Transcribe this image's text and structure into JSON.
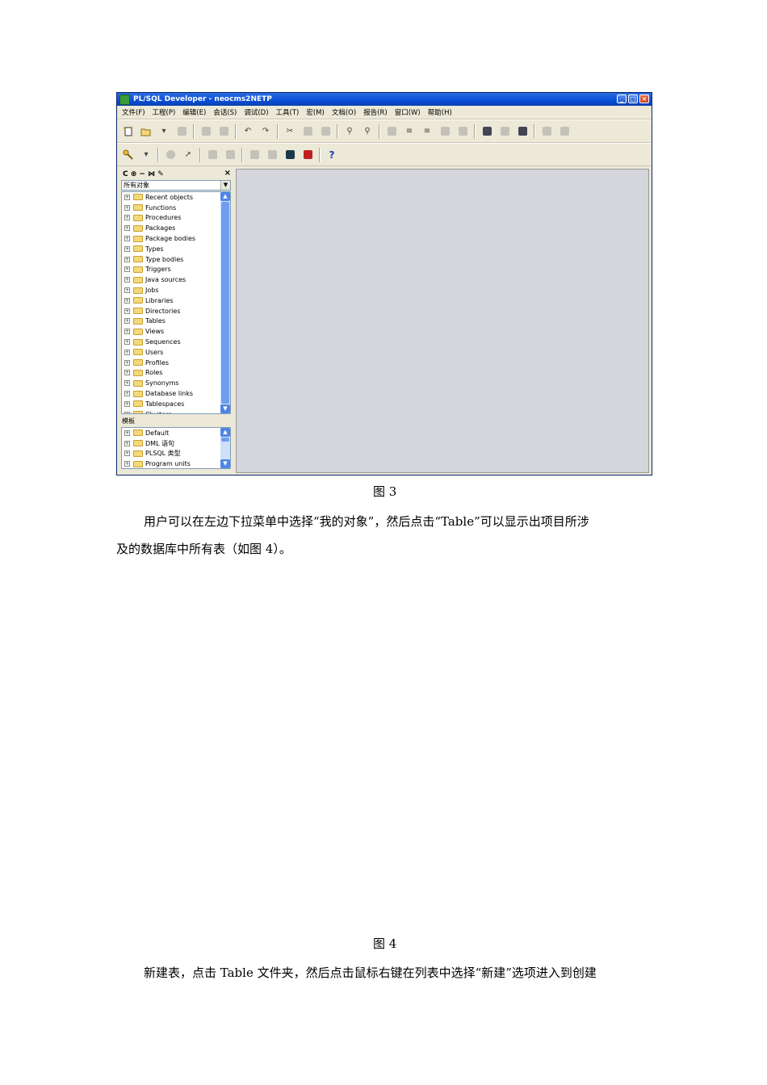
{
  "window": {
    "title": "PL/SQL Developer - neocms2NETP",
    "controls": [
      "_",
      "□",
      "×"
    ],
    "menu": [
      "文件(F)",
      "工程(P)",
      "编辑(E)",
      "会话(S)",
      "调试(D)",
      "工具(T)",
      "宏(M)",
      "文档(O)",
      "报告(R)",
      "窗口(W)",
      "帮助(H)"
    ],
    "toolbar2_help": "?",
    "left_panel": {
      "filter_select": "所有对象",
      "close": "×",
      "tool_glyphs": "C ⊕ − ⋈ ✎",
      "object_tree": [
        "Recent objects",
        "Functions",
        "Procedures",
        "Packages",
        "Package bodies",
        "Types",
        "Type bodies",
        "Triggers",
        "Java sources",
        "Jobs",
        "Libraries",
        "Directories",
        "Tables",
        "Views",
        "Sequences",
        "Users",
        "Profiles",
        "Roles",
        "Synonyms",
        "Database links",
        "Tablespaces",
        "Clusters"
      ],
      "templates_label": "模板",
      "template_tree": [
        "Default",
        "DML 语句",
        "PLSQL 类型",
        "Program units"
      ]
    }
  },
  "doc": {
    "caption3": "图 3",
    "para1_line1": "用户可以在左边下拉菜单中选择“我的对象”，然后点击“Table”可以显示出项目所涉",
    "para1_line2": "及的数据库中所有表（如图 4）。",
    "caption4": "图 4",
    "para2_line1": "新建表，点击 Table 文件夹，然后点击鼠标右键在列表中选择“新建”选项进入到创建"
  }
}
